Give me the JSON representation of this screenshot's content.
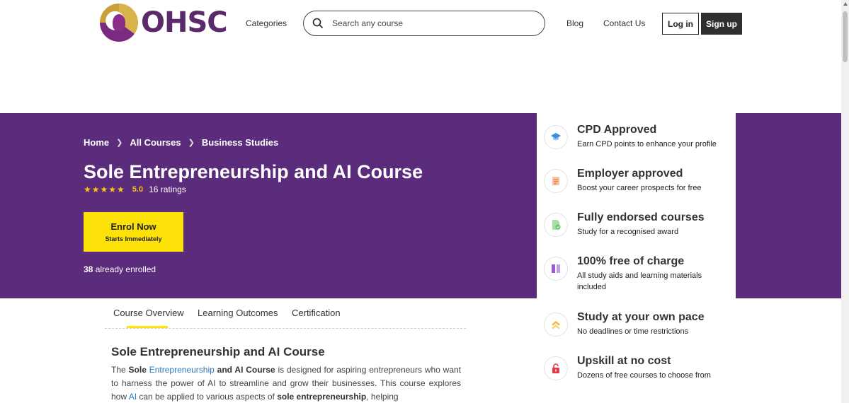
{
  "header": {
    "logo_text": "OHSC",
    "categories_label": "Categories",
    "search_placeholder": "Search any course",
    "blog_label": "Blog",
    "contact_label": "Contact Us",
    "login_label": "Log in",
    "signup_label": "Sign up"
  },
  "hero": {
    "breadcrumb": [
      "Home",
      "All Courses",
      "Business Studies"
    ],
    "title": "Sole Entrepreneurship and AI Course",
    "stars": "★★★★★",
    "rating": "5.0",
    "rating_count": "16 ratings",
    "enrol_label": "Enrol Now",
    "enrol_sub": "Starts Immediately",
    "enrolled_count": "38",
    "enrolled_suffix": "already enrolled"
  },
  "features": [
    {
      "icon": "graduation-cap-icon",
      "title": "CPD Approved",
      "desc": "Earn CPD points to enhance your profile",
      "color": "#3a8fd8"
    },
    {
      "icon": "certificate-icon",
      "title": "Employer approved",
      "desc": "Boost your career prospects for free",
      "color": "#e8875f"
    },
    {
      "icon": "document-check-icon",
      "title": "Fully endorsed courses",
      "desc": "Study for a recognised award",
      "color": "#6cc56a"
    },
    {
      "icon": "book-icon",
      "title": "100% free of charge",
      "desc": "All study aids and learning materials included",
      "color": "#a05ad1"
    },
    {
      "icon": "chevrons-up-icon",
      "title": "Study at your own pace",
      "desc": "No deadlines or time restrictions",
      "color": "#f2b82a"
    },
    {
      "icon": "lock-icon",
      "title": "Upskill at no cost",
      "desc": "Dozens of free courses to choose from",
      "color": "#e23a4a"
    }
  ],
  "tabs": [
    "Course Overview",
    "Learning Outcomes",
    "Certification"
  ],
  "overview": {
    "title": "Sole Entrepreneurship and AI Course",
    "p_the": "The",
    "p_sole": "Sole",
    "p_link1": "Entrepreneurship",
    "p_and_ai": "and AI Course",
    "p_mid": "is designed for aspiring entrepreneurs who want to harness the power of AI to streamline and grow their businesses. This course explores how",
    "p_link2": "AI",
    "p_mid2": "can be applied to various aspects of",
    "p_bold2": "sole entrepreneurship",
    "p_end": ", helping"
  }
}
